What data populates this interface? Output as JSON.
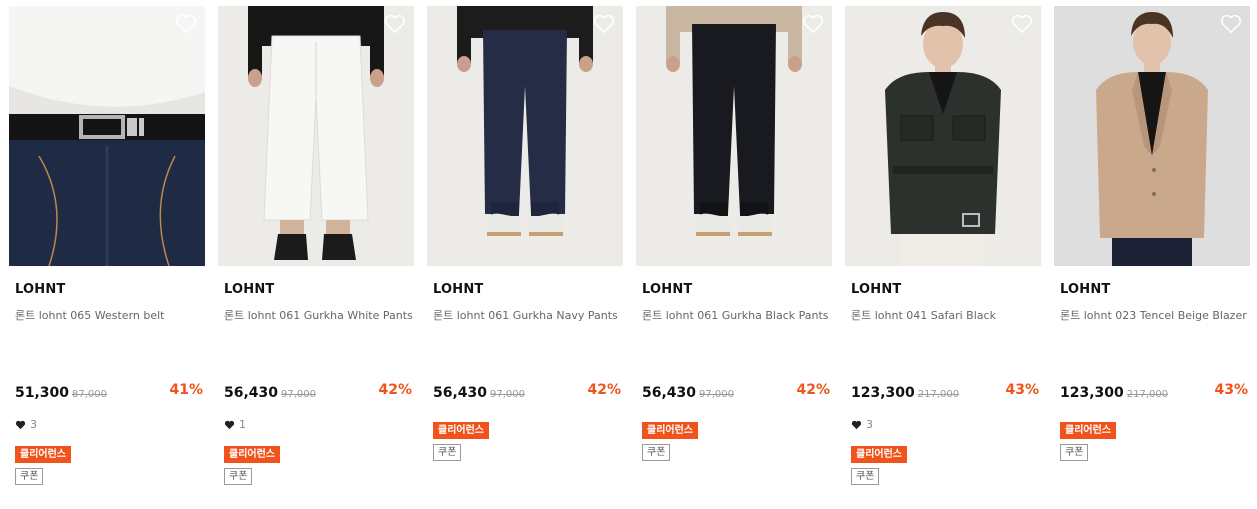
{
  "colors": {
    "accent": "#f0531c",
    "text": "#111111",
    "muted": "#999999"
  },
  "products": [
    {
      "brand": "LOHNT",
      "name": "론트 lohnt 065 Western belt",
      "price": "51,300",
      "original_price": "87,000",
      "discount": "41%",
      "likes": "3",
      "badge": "클리어런스",
      "coupon": "쿠폰"
    },
    {
      "brand": "LOHNT",
      "name": "론트 lohnt 061 Gurkha White Pants",
      "price": "56,430",
      "original_price": "97,000",
      "discount": "42%",
      "likes": "1",
      "badge": "클리어런스",
      "coupon": "쿠폰"
    },
    {
      "brand": "LOHNT",
      "name": "론트 lohnt 061 Gurkha Navy Pants",
      "price": "56,430",
      "original_price": "97,000",
      "discount": "42%",
      "likes": null,
      "badge": "클리어런스",
      "coupon": "쿠폰"
    },
    {
      "brand": "LOHNT",
      "name": "론트 lohnt 061 Gurkha Black Pants",
      "price": "56,430",
      "original_price": "97,000",
      "discount": "42%",
      "likes": null,
      "badge": "클리어런스",
      "coupon": "쿠폰"
    },
    {
      "brand": "LOHNT",
      "name": "론트 lohnt 041 Safari Black",
      "price": "123,300",
      "original_price": "217,000",
      "discount": "43%",
      "likes": "3",
      "badge": "클리어런스",
      "coupon": "쿠폰"
    },
    {
      "brand": "LOHNT",
      "name": "론트 lohnt 023 Tencel Beige Blazer",
      "price": "123,300",
      "original_price": "217,000",
      "discount": "43%",
      "likes": null,
      "badge": "클리어런스",
      "coupon": "쿠폰"
    }
  ]
}
